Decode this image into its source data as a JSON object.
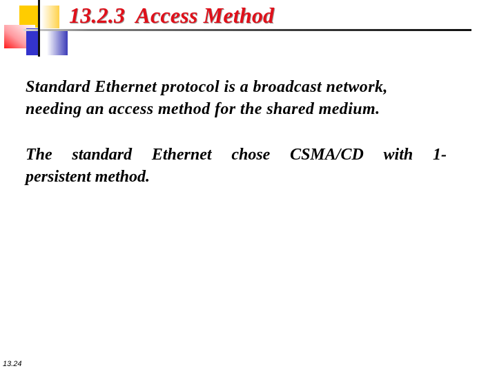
{
  "slide": {
    "title": "13.2.3  Access Method",
    "title_color": "#e0101a",
    "paragraphs": [
      {
        "line1": "Standard Ethernet protocol is a broadcast network,",
        "line2": "needing an access method for the shared medium."
      },
      {
        "line1": "The standard Ethernet chose CSMA/CD with 1-",
        "line2": "persistent method."
      }
    ],
    "slide_number": "13.24"
  },
  "decoration": {
    "icon": "logo-squares-icon",
    "colors": {
      "yellow": "#ffcc00",
      "red": "#ff1a1a",
      "blue": "#3333cc",
      "rule": "#111111"
    }
  }
}
